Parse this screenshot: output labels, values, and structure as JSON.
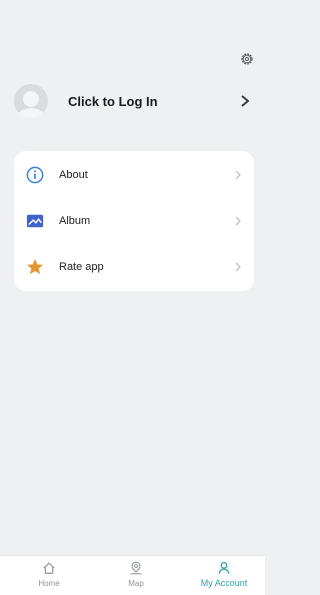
{
  "header": {
    "settings_icon": "gear-icon"
  },
  "login": {
    "label": "Click to Log In",
    "avatar_icon": "avatar-placeholder-icon",
    "chevron_icon": "chevron-right-icon"
  },
  "menu": {
    "items": [
      {
        "label": "About",
        "icon": "info-icon",
        "icon_color": "#3a7de0"
      },
      {
        "label": "Album",
        "icon": "image-icon",
        "icon_color": "#3f63c8"
      },
      {
        "label": "Rate app",
        "icon": "star-icon",
        "icon_color": "#e29531"
      }
    ]
  },
  "tabbar": {
    "tabs": [
      {
        "label": "Home",
        "icon": "home-icon",
        "active": false
      },
      {
        "label": "Map",
        "icon": "map-pin-icon",
        "active": false
      },
      {
        "label": "My Account",
        "icon": "user-icon",
        "active": true
      }
    ],
    "active_color": "#2ea3a6",
    "inactive_color": "#8e9397"
  }
}
